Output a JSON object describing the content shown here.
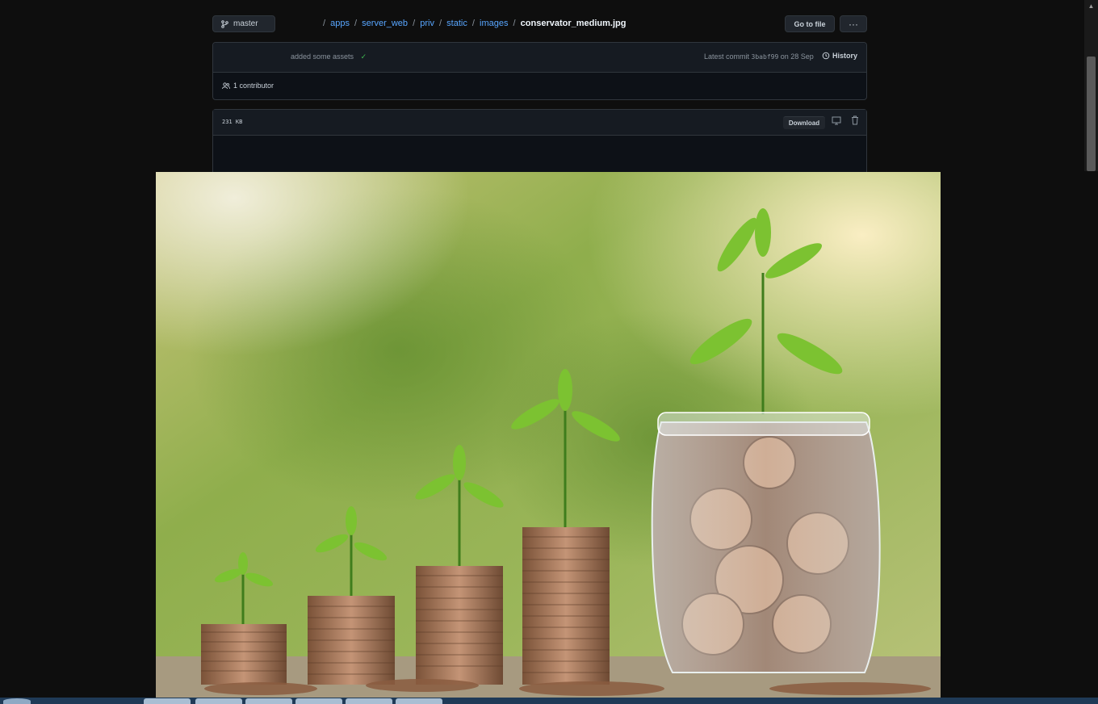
{
  "toolbar": {
    "branch": "master",
    "breadcrumb": [
      {
        "label": "apps"
      },
      {
        "label": "server_web"
      },
      {
        "label": "priv"
      },
      {
        "label": "static"
      },
      {
        "label": "images"
      }
    ],
    "current_file": "conservator_medium.jpg",
    "go_to_file_label": "Go to file",
    "more_label": "···"
  },
  "commit": {
    "message": "added some assets",
    "latest_label": "Latest commit",
    "sha": "3babf99",
    "date_text": "on 28 Sep",
    "history_label": "History",
    "contributors_label": "1 contributor"
  },
  "file": {
    "size": "231 KB",
    "download_label": "Download"
  },
  "colors": {
    "accent_link": "#58a6ff",
    "success": "#3fb950",
    "background": "#0d1117"
  },
  "icons": [
    "branch-icon",
    "check-icon",
    "history-icon",
    "people-icon",
    "desktop-icon",
    "trash-icon"
  ]
}
